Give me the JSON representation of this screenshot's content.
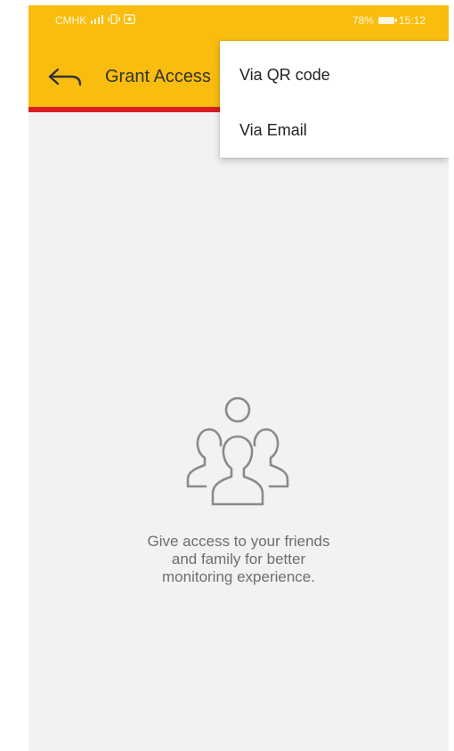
{
  "status_bar": {
    "carrier": "CMHK",
    "battery_percent": "78%",
    "time": "15:12"
  },
  "toolbar": {
    "title": "Grant Access",
    "back_icon": "arrow-left-icon"
  },
  "menu": {
    "items": [
      {
        "label": "Via QR code"
      },
      {
        "label": "Via Email"
      }
    ]
  },
  "empty_state": {
    "icon": "people-group-icon",
    "lines": [
      "Give access to your friends",
      "and family for better",
      "monitoring experience."
    ]
  },
  "colors": {
    "toolbar": "#f8bd0f",
    "accent_line": "#d81e1e",
    "background": "#f2f2f2"
  }
}
